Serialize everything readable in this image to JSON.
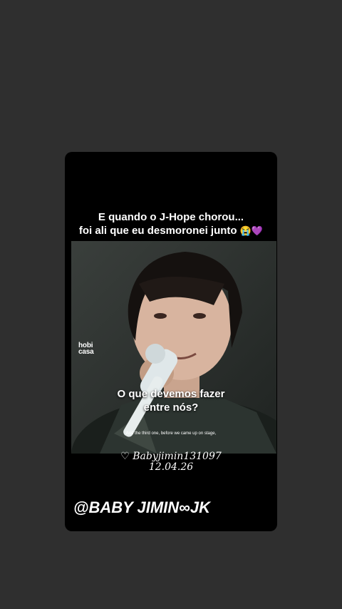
{
  "story": {
    "caption_line1": "E quando o J-Hope chorou...",
    "caption_line2": "foi ali que eu desmoronei junto",
    "caption_emoji": "😭💜",
    "stage_logo_line1": "hobi",
    "stage_logo_line2": "casa",
    "subtitle_pt_line1": "O que devemos fazer",
    "subtitle_pt_line2": "entre nós?",
    "subtitle_en": "And the third one, before we came up on stage,",
    "user_tag": "Babyjimin131097",
    "date": "12.04.26",
    "handle": "@BABY JIMIN∞JK"
  },
  "colors": {
    "background": "#2f2f2f",
    "card": "#000000",
    "video_bg": "#2b2f2d",
    "text": "#ffffff"
  }
}
